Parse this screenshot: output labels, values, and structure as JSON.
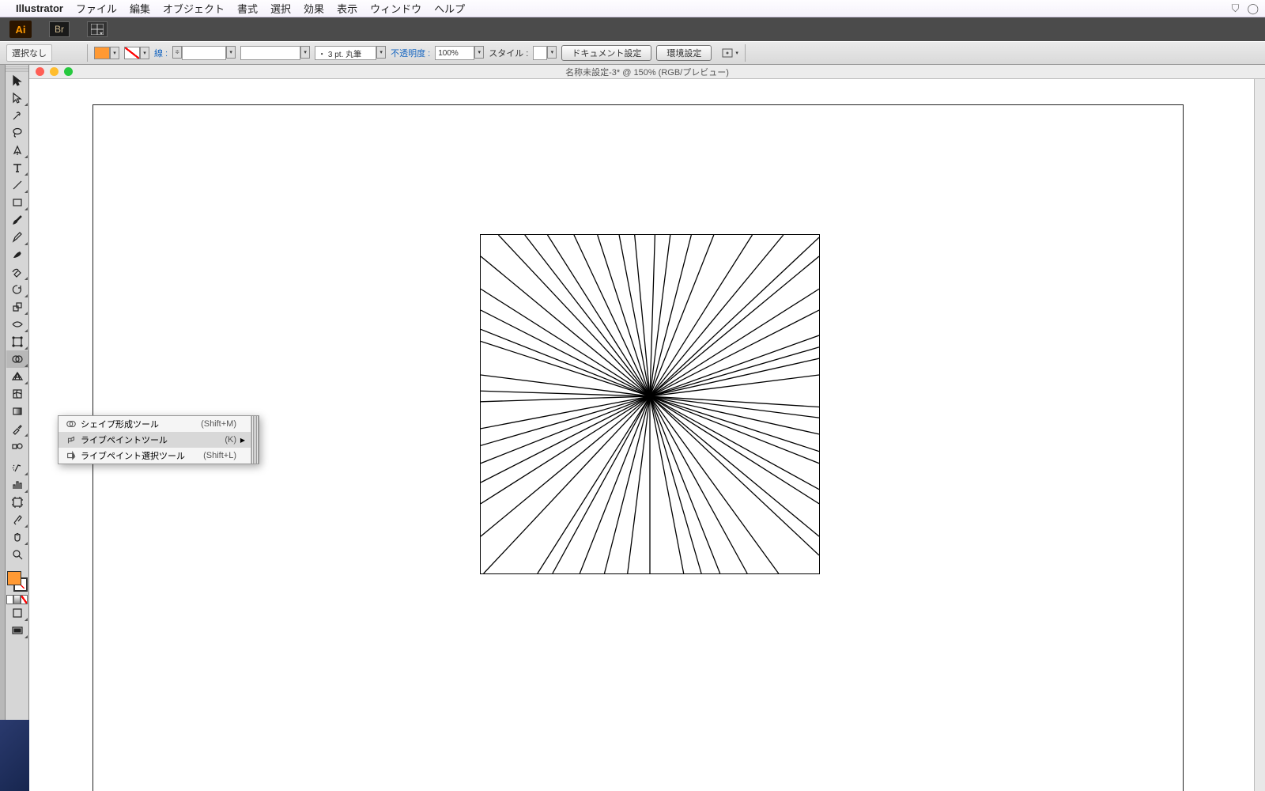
{
  "menubar": {
    "app": "Illustrator",
    "items": [
      "ファイル",
      "編集",
      "オブジェクト",
      "書式",
      "選択",
      "効果",
      "表示",
      "ウィンドウ",
      "ヘルプ"
    ]
  },
  "appbar": {
    "ai": "Ai",
    "br": "Br"
  },
  "controlbar": {
    "selection": "選択なし",
    "stroke_label": "線 :",
    "stroke_weight_prefix": "・ 3 pt. 丸筆",
    "opacity_label": "不透明度 :",
    "opacity_value": "100%",
    "style_label": "スタイル :",
    "doc_setup": "ドキュメント設定",
    "prefs": "環境設定"
  },
  "document": {
    "title": "名称未設定-3* @ 150% (RGB/プレビュー)"
  },
  "flyout": {
    "items": [
      {
        "label": "シェイプ形成ツール",
        "shortcut": "(Shift+M)",
        "hover": false,
        "sub": false
      },
      {
        "label": "ライブペイントツール",
        "shortcut": "(K)",
        "hover": true,
        "sub": true
      },
      {
        "label": "ライブペイント選択ツール",
        "shortcut": "(Shift+L)",
        "hover": false,
        "sub": false
      }
    ]
  },
  "tools": [
    "selection",
    "direct-selection",
    "magic-wand",
    "lasso",
    "pen",
    "type",
    "line",
    "rectangle",
    "paintbrush",
    "pencil",
    "blob-brush",
    "eraser",
    "rotate",
    "scale",
    "width",
    "free-transform",
    "shape-builder",
    "perspective-grid",
    "mesh",
    "gradient",
    "eyedropper",
    "blend",
    "symbol-sprayer",
    "column-graph",
    "artboard",
    "slice",
    "hand",
    "zoom"
  ],
  "colors": {
    "fill": "#ff9933"
  }
}
